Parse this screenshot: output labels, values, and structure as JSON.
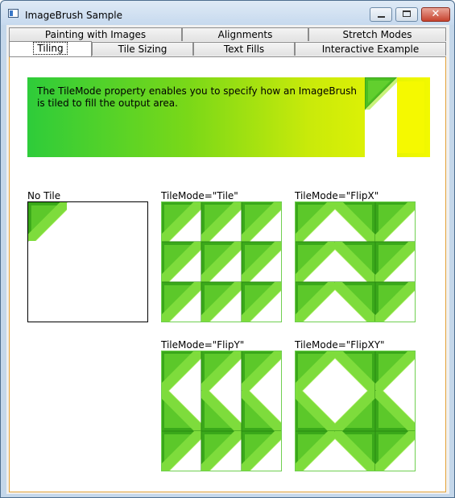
{
  "window": {
    "title": "ImageBrush Sample",
    "close_glyph": "✕"
  },
  "tabs": {
    "row1": [
      "Painting with Images",
      "Alignments",
      "Stretch Modes"
    ],
    "row2": [
      "Tiling",
      "Tile Sizing",
      "Text Fills",
      "Interactive Example"
    ],
    "selected": "Tiling"
  },
  "panel": {
    "description": "The TileMode property enables you to specify how an ImageBrush is tiled to fill the output area.",
    "examples": {
      "none": "No Tile",
      "tile": "TileMode=\"Tile\"",
      "flipx": "TileMode=\"FlipX\"",
      "flipy": "TileMode=\"FlipY\"",
      "flipxy": "TileMode=\"FlipXY\""
    }
  },
  "colors": {
    "tile_green_dark": "#3aa81a",
    "tile_green_light": "#a8ec5c",
    "banner_start": "#2ecc3a",
    "banner_end": "#f2f800",
    "selected_panel_border": "#e3a238"
  },
  "icons": {
    "app": "window-icon",
    "minimize": "minimize-icon",
    "maximize": "maximize-icon",
    "close": "close-icon"
  }
}
